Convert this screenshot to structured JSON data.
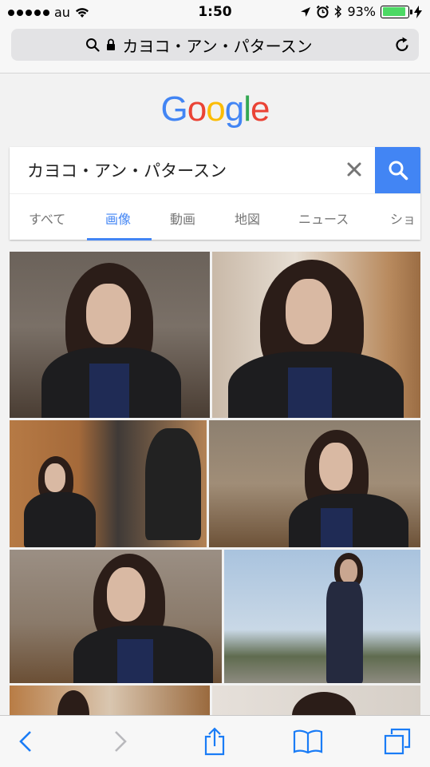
{
  "status_bar": {
    "carrier": "au",
    "time": "1:50",
    "battery_percent": "93%",
    "battery_level": 0.93
  },
  "url_bar": {
    "text": "カヨコ・アン・パタースン"
  },
  "google": {
    "logo": {
      "letters": [
        "G",
        "o",
        "o",
        "g",
        "l",
        "e"
      ],
      "colors": [
        "#4285f4",
        "#ea4335",
        "#fbbc05",
        "#4285f4",
        "#34a853",
        "#ea4335"
      ]
    },
    "query": "カヨコ・アン・パタースン",
    "search_color": "#4285f4",
    "tabs": [
      {
        "label": "すべて",
        "active": false
      },
      {
        "label": "画像",
        "active": true
      },
      {
        "label": "動画",
        "active": false
      },
      {
        "label": "地図",
        "active": false
      },
      {
        "label": "ニュース",
        "active": false
      },
      {
        "label": "ショ",
        "active": false
      }
    ]
  },
  "toolbar": {
    "icons": [
      "back-icon",
      "forward-icon",
      "share-icon",
      "bookmarks-icon",
      "tabs-icon"
    ]
  }
}
